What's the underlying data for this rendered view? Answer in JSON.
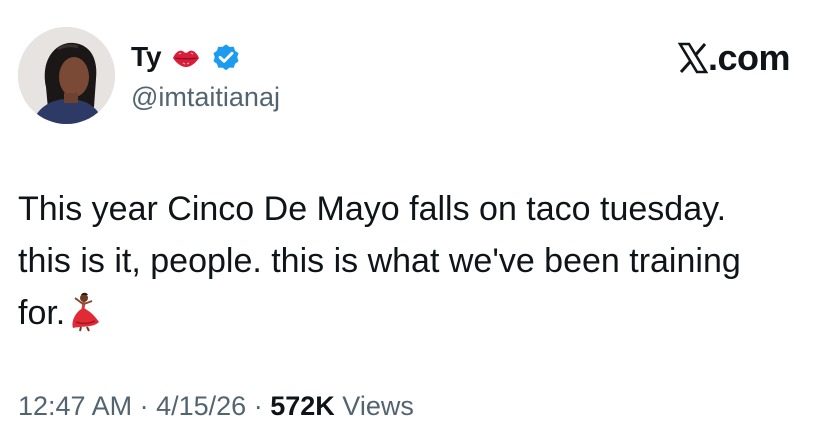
{
  "author": {
    "display_name": "Ty",
    "handle": "@imtaitianaj",
    "name_emoji_icon": "kiss-lips-icon",
    "verified_icon": "verified-badge-icon",
    "verified_color": "#1d9bf0"
  },
  "brand": {
    "icon": "x-logo-icon",
    "text": ".com"
  },
  "tweet": {
    "line1": "This year Cinco De Mayo falls on taco tuesday.",
    "line2": "this is it, people. this is what we've been training",
    "line3": "for.",
    "trailing_emoji_icon": "dancer-icon"
  },
  "meta": {
    "time": "12:47 AM",
    "separator": "·",
    "date": "4/15/26",
    "views_count": "572K",
    "views_label": "Views"
  },
  "colors": {
    "text_primary": "#0f1419",
    "text_secondary": "#536471",
    "background": "#ffffff"
  }
}
